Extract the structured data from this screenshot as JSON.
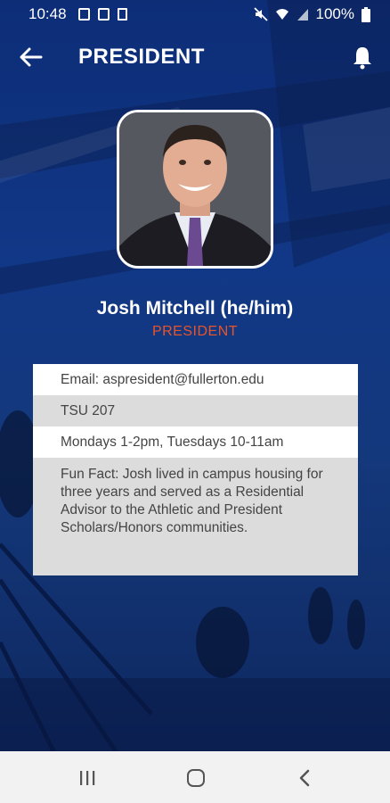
{
  "status_bar": {
    "time": "10:48",
    "battery": "100%"
  },
  "app_bar": {
    "title": "PRESIDENT"
  },
  "profile": {
    "name": "Josh Mitchell (he/him)",
    "role": "PRESIDENT"
  },
  "details": {
    "email": "Email: aspresident@fullerton.edu",
    "office": "TSU 207",
    "hours": "Mondays 1-2pm, Tuesdays 10-11am",
    "fun_fact": "Fun Fact: Josh lived in campus housing for three years and served as a Residential Advisor to the Athletic and President Scholars/Honors communities."
  },
  "colors": {
    "primary": "#123a8c",
    "accent": "#e8542a"
  }
}
